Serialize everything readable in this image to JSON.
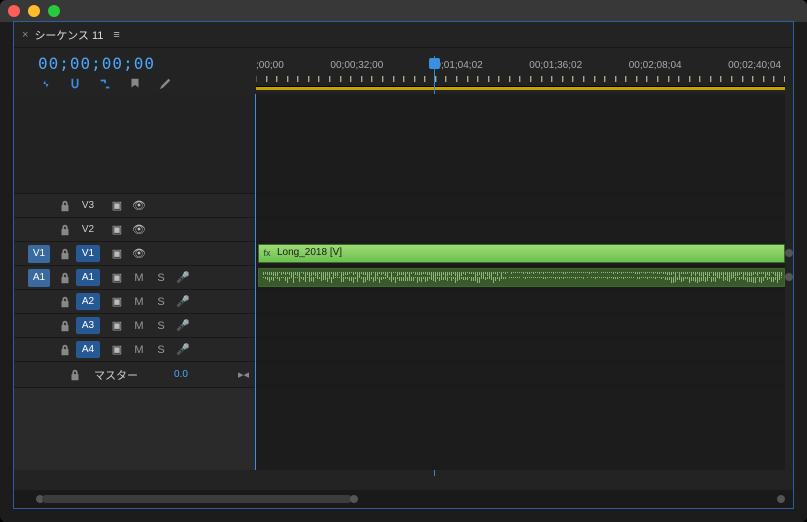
{
  "tab": {
    "name": "シーケンス 11"
  },
  "timecode": "00;00;00;00",
  "ruler": {
    "labels": [
      ";00;00",
      "00;00;32;00",
      "00;01;04;02",
      "00;01;36;02",
      "00;02;08;04",
      "00;02;40;04"
    ]
  },
  "tracks": {
    "video": [
      {
        "src": "",
        "tgt": "V3",
        "on": false
      },
      {
        "src": "",
        "tgt": "V2",
        "on": false
      },
      {
        "src": "V1",
        "tgt": "V1",
        "on": true
      }
    ],
    "audio": [
      {
        "src": "A1",
        "tgt": "A1",
        "on": true
      },
      {
        "src": "",
        "tgt": "A2",
        "on": true
      },
      {
        "src": "",
        "tgt": "A3",
        "on": true
      },
      {
        "src": "",
        "tgt": "A4",
        "on": true
      }
    ],
    "buttons": {
      "m": "M",
      "s": "S"
    },
    "master": {
      "label": "マスター",
      "value": "0.0"
    }
  },
  "clip": {
    "video_label": "Long_2018 [V]"
  }
}
